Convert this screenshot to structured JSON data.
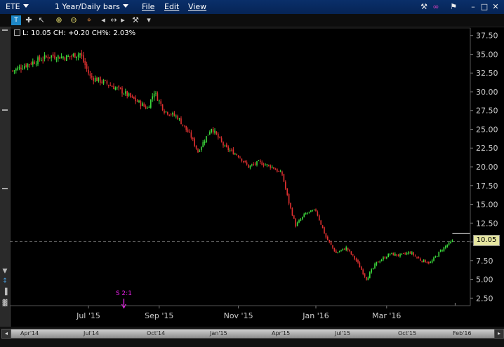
{
  "window": {
    "symbol": "ETE",
    "period": "1 Year/Daily bars",
    "menus": [
      "File",
      "Edit",
      "View"
    ]
  },
  "icons": {
    "title": [
      "wrench-icon",
      "link-icon",
      "flag-icon",
      "minimize-icon",
      "maximize-icon",
      "close-icon"
    ],
    "toolbar": [
      "chart-type-icon",
      "crosshair-icon",
      "drawing-icon",
      "zoom-in-icon",
      "zoom-out-icon",
      "crosshair-cursor-icon",
      "pan-left-icon",
      "pan-both-icon",
      "pan-right-icon",
      "settings-icon",
      "dropdown-icon"
    ]
  },
  "readout": {
    "text": "L: 10.05 CH: +0.20 CH%: 2.03%"
  },
  "last_price": "10.05",
  "event_label": "S 2:1",
  "navigator": {
    "labels": [
      "Apr'14",
      "Jul'14",
      "Oct'14",
      "Jan'15",
      "Apr'15",
      "Jul'15",
      "Oct'15",
      "Feb'16"
    ]
  },
  "colors": {
    "up": "#3cdc3c",
    "down": "#e03030",
    "background": "#000000",
    "title_bar": "#062456",
    "price_box": "#e6e6a0",
    "event": "#e020e0"
  },
  "chart_data": {
    "type": "candlestick",
    "x_labels": [
      "Jul '15",
      "Sep '15",
      "Nov '15",
      "Jan '16",
      "Mar '16"
    ],
    "y_ticks": [
      "37.50",
      "35.00",
      "32.50",
      "30.00",
      "27.50",
      "25.00",
      "22.50",
      "20.00",
      "17.50",
      "15.00",
      "12.50",
      "10.00",
      "7.50",
      "5.00",
      "2.50"
    ],
    "ylim": [
      1.5,
      38.5
    ],
    "grid": false,
    "x_range_trading_days": [
      0,
      270
    ],
    "x_tick_days": [
      45,
      87,
      134,
      180,
      222
    ],
    "event_day": 66,
    "last_line_day": 261,
    "trend_points": [
      [
        0,
        32.8
      ],
      [
        10,
        33.8
      ],
      [
        22,
        34.8
      ],
      [
        32,
        34.6
      ],
      [
        40,
        35.1
      ],
      [
        46,
        32.0
      ],
      [
        55,
        31.2
      ],
      [
        64,
        30.2
      ],
      [
        72,
        29.0
      ],
      [
        80,
        27.8
      ],
      [
        84,
        30.0
      ],
      [
        90,
        27.5
      ],
      [
        98,
        26.6
      ],
      [
        106,
        24.0
      ],
      [
        110,
        22.0
      ],
      [
        118,
        25.2
      ],
      [
        126,
        22.6
      ],
      [
        134,
        21.5
      ],
      [
        140,
        20.0
      ],
      [
        146,
        20.6
      ],
      [
        154,
        20.0
      ],
      [
        160,
        19.0
      ],
      [
        164,
        15.2
      ],
      [
        168,
        12.2
      ],
      [
        174,
        13.8
      ],
      [
        180,
        14.2
      ],
      [
        186,
        10.6
      ],
      [
        192,
        8.5
      ],
      [
        198,
        9.2
      ],
      [
        204,
        7.5
      ],
      [
        210,
        5.1
      ],
      [
        216,
        7.2
      ],
      [
        224,
        8.4
      ],
      [
        230,
        8.2
      ],
      [
        236,
        8.6
      ],
      [
        242,
        7.6
      ],
      [
        248,
        7.2
      ],
      [
        254,
        8.8
      ],
      [
        258,
        9.6
      ],
      [
        261,
        10.05
      ]
    ]
  }
}
